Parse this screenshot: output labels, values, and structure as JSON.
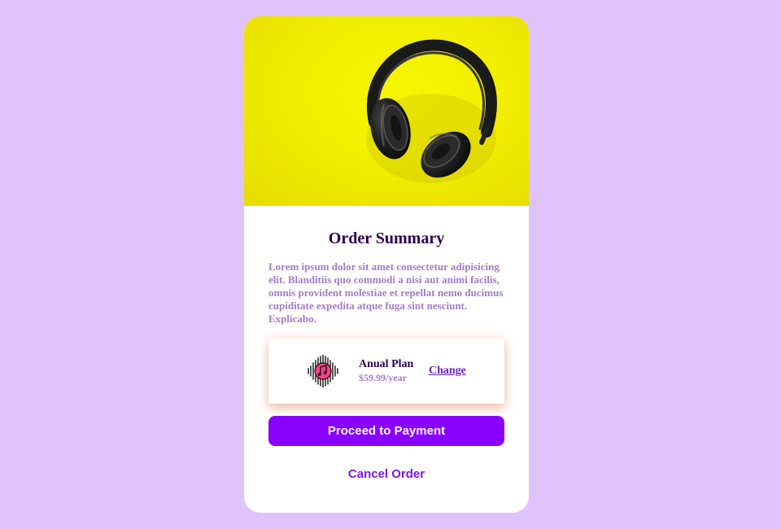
{
  "summary": {
    "hero_image": "headphones-on-yellow-image",
    "title": "Order Summary",
    "description": "Lorem ipsum dolor sit amet consectetur adipisicing elit. Blanditiis quo commodi a nisi aut animi facilis, omnis provident molestiae et repellat nemo ducimus cupiditate expedita atque fuga sint nesciunt. Explicabo.",
    "plan": {
      "icon": "music-note-icon",
      "name": "Anual Plan",
      "price": "$59.99/year",
      "change_label": "Change"
    },
    "proceed_label": "Proceed to Payment",
    "cancel_label": "Cancel Order"
  },
  "colors": {
    "page_background": "#e0c3fc",
    "card_background": "#ffffff",
    "hero_background": "#f2ee00",
    "title": "#2b0050",
    "muted_text": "#a47bc6",
    "primary_button": "#8a00ff",
    "link": "#7a1be0",
    "plan_icon_accent": "#ff3e8a"
  }
}
